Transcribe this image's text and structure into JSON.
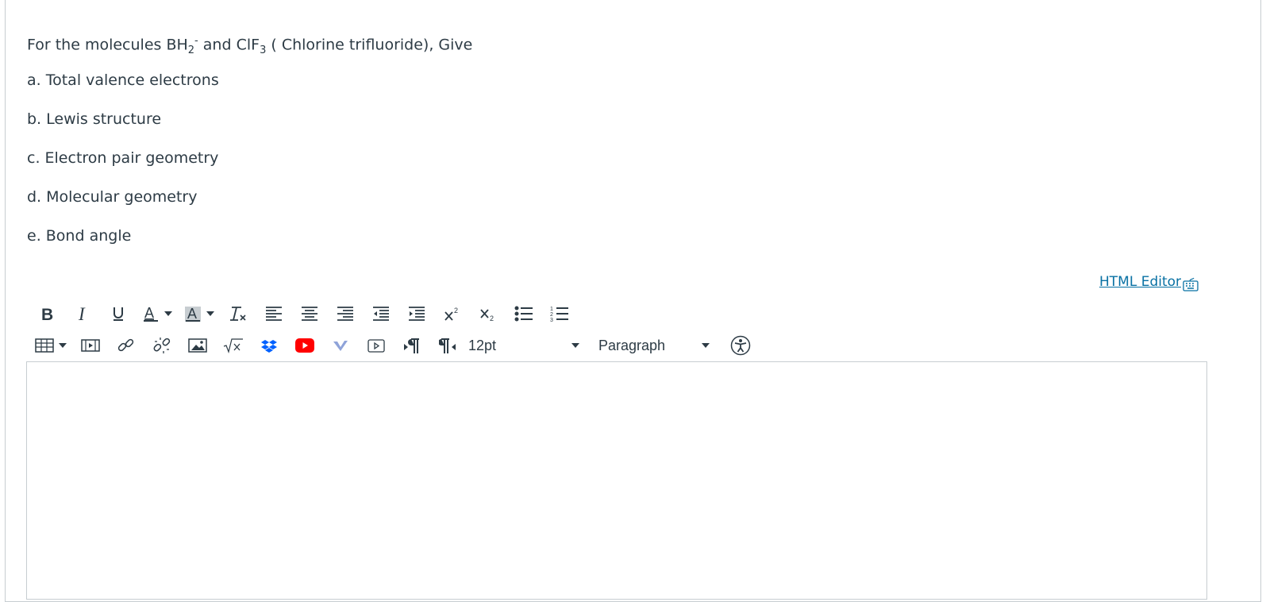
{
  "question": {
    "intro": {
      "prefix": "For the molecules BH",
      "bh_sub": "2",
      "bh_sup": "-",
      "middle": " and ClF",
      "clf_sub": "3",
      "suffix": " ( Chlorine trifluoride), Give"
    },
    "items": [
      "a. Total valence electrons",
      "b. Lewis structure",
      "c. Electron pair geometry",
      "d. Molecular geometry",
      "e. Bond angle"
    ]
  },
  "editor": {
    "html_editor_link": "HTML Editor",
    "font_size": "12pt",
    "block_format": "Paragraph",
    "colors": {
      "link": "#0770a3",
      "text": "#2d3b45",
      "youtube": "#ff0000",
      "dropbox": "#0061ff",
      "vimeo": "#8fa3d9"
    },
    "toolbar_icons": [
      "bold-icon",
      "italic-icon",
      "underline-icon",
      "text-color-icon",
      "background-color-icon",
      "clear-formatting-icon",
      "align-left-icon",
      "align-center-icon",
      "align-right-icon",
      "outdent-icon",
      "indent-icon",
      "superscript-icon",
      "subscript-icon",
      "bullet-list-icon",
      "numbered-list-icon",
      "table-icon",
      "media-icon",
      "link-icon",
      "unlink-icon",
      "image-icon",
      "math-icon",
      "dropbox-icon",
      "youtube-icon",
      "vimeo-icon",
      "video-icon",
      "ltr-icon",
      "rtl-icon",
      "accessibility-icon"
    ]
  }
}
